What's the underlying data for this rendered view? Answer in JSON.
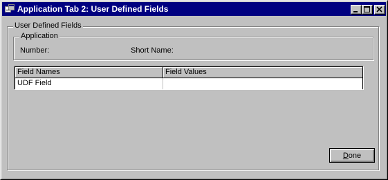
{
  "window": {
    "title": "Application Tab 2: User Defined Fields",
    "icon": "application-icon",
    "controls": {
      "minimize": "minimize-icon",
      "maximize": "maximize-icon",
      "close": "close-icon"
    }
  },
  "udf_group": {
    "label": "User Defined Fields",
    "application_group": {
      "label": "Application",
      "number_label": "Number:",
      "short_name_label": "Short Name:"
    }
  },
  "grid": {
    "columns": [
      "Field Names",
      "Field Values"
    ],
    "rows": [
      {
        "name": "UDF Field",
        "value": ""
      }
    ]
  },
  "buttons": {
    "done_accel": "D",
    "done_rest": "one"
  },
  "colors": {
    "titlebar": "#000080",
    "face": "#c0c0c0"
  }
}
